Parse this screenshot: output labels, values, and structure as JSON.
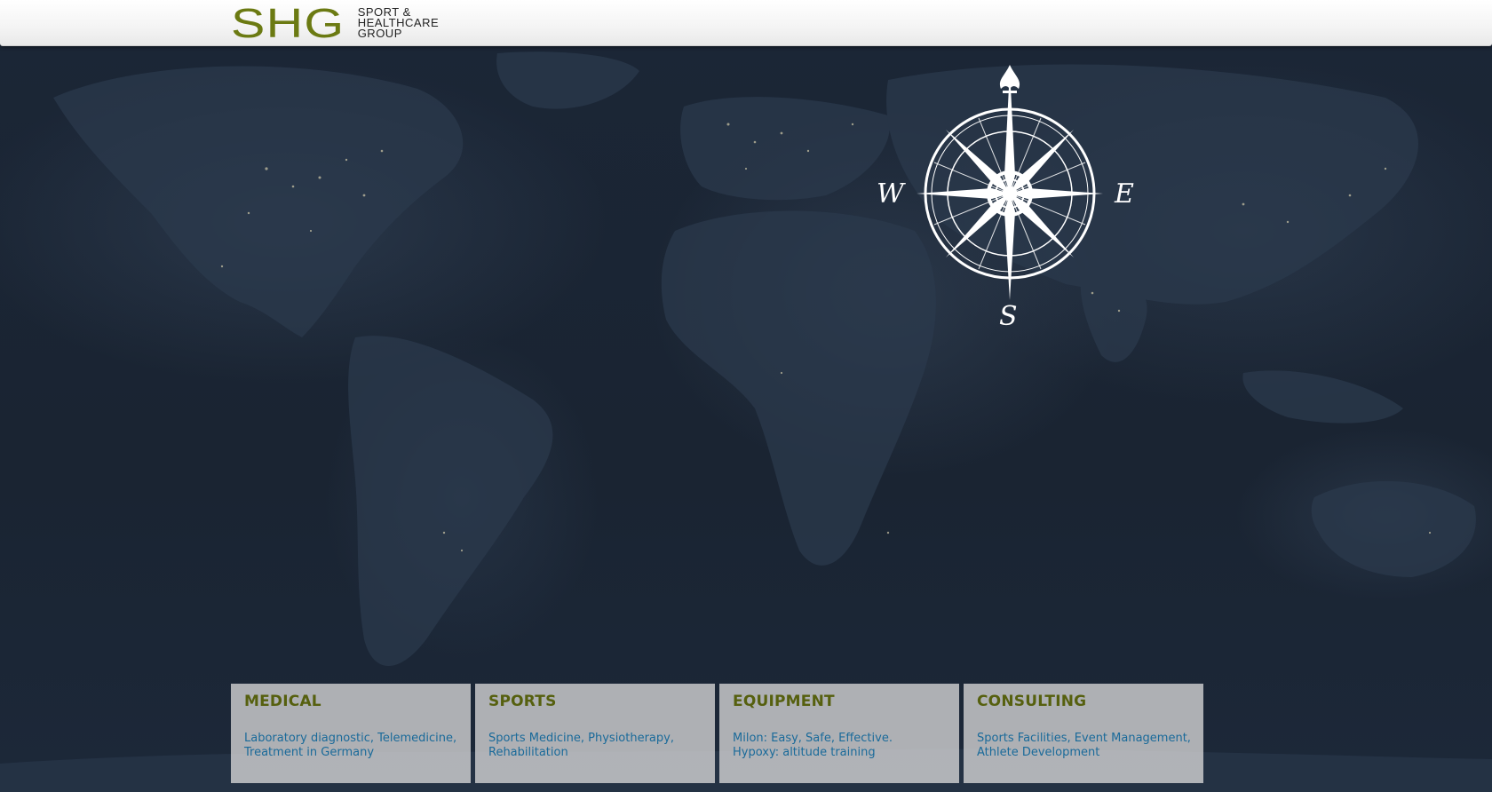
{
  "header": {
    "logo_mark": "SHG",
    "logo_lines": [
      "SPORT &",
      "HEALTHCARE",
      "GROUP"
    ]
  },
  "compass": {
    "west": "W",
    "east": "E",
    "south": "S"
  },
  "cards": [
    {
      "title": "MEDICAL",
      "lines": [
        "Laboratory diagnostic, Telemedicine,",
        "Treatment in Germany"
      ]
    },
    {
      "title": "SPORTS",
      "lines": [
        "Sports Medicine, Physiotherapy,",
        "Rehabilitation"
      ]
    },
    {
      "title": "EQUIPMENT",
      "lines": [
        "Milon: Easy, Safe, Effective.",
        "Hypoxy: altitude training"
      ]
    },
    {
      "title": "CONSULTING",
      "lines": [
        "Sports Facilities, Event Management,",
        "Athlete Development"
      ]
    }
  ],
  "colors": {
    "brand_olive": "#6b7a12",
    "card_title": "#56600f",
    "card_link": "#1a6a9a"
  }
}
